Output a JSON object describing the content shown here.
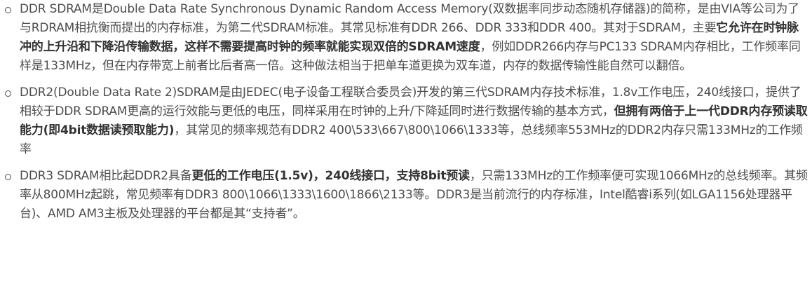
{
  "bullets": [
    {
      "segments": [
        {
          "text": "DDR SDRAM是Double Data Rate Synchronous Dynamic Random Access Memory(双数据率同步动态随机存储器)的简称，是由VIA等公司为了与RDRAM相抗衡而提出的内存标准，为第二代SDRAM标准。其常见标准有DDR 266、DDR 333和DDR 400。其对于SDRAM，主要",
          "bold": false
        },
        {
          "text": "它允许在时钟脉冲的上升沿和下降沿传输数据，这样不需要提高时钟的频率就能实现双倍的SDRAM速度",
          "bold": true
        },
        {
          "text": "，例如DDR266内存与PC133 SDRAM内存相比，工作频率同样是133MHz，但在内存带宽上前者比后者高一倍。这种做法相当于把单车道更换为双车道，内存的数据传输性能自然可以翻倍。",
          "bold": false
        }
      ]
    },
    {
      "segments": [
        {
          "text": "DDR2(Double Data Rate 2)SDRAM是由JEDEC(电子设备工程联合委员会)开发的第三代SDRAM内存技术标准，1.8v工作电压，240线接口，提供了相较于DDR SDRAM更高的运行效能与更低的电压，同样采用在时钟的上升/下降延同时进行数据传输的基本方式，",
          "bold": false
        },
        {
          "text": "但拥有两倍于上一代DDR内存预读取能力(即4bit数据读预取能力)",
          "bold": true
        },
        {
          "text": "，其常见的频率规范有DDR2 400\\533\\667\\800\\1066\\1333等，总线频率553MHz的DDR2内存只需133MHz的工作频率",
          "bold": false
        }
      ]
    },
    {
      "segments": [
        {
          "text": "DDR3 SDRAM相比起DDR2具备",
          "bold": false
        },
        {
          "text": "更低的工作电压(1.5v)，240线接口，支持8bit预读",
          "bold": true
        },
        {
          "text": "，只需133MHz的工作频率便可实现1066MHz的总线频率。其频率从800MHz起跳，常见频率有DDR3 800\\1066\\1333\\1600\\1866\\2133等。DDR3是当前流行的内存标准，Intel酷睿i系列(如LGA1156处理器平台)、AMD AM3主板及处理器的平台都是其“支持者”。",
          "bold": false
        }
      ]
    }
  ]
}
